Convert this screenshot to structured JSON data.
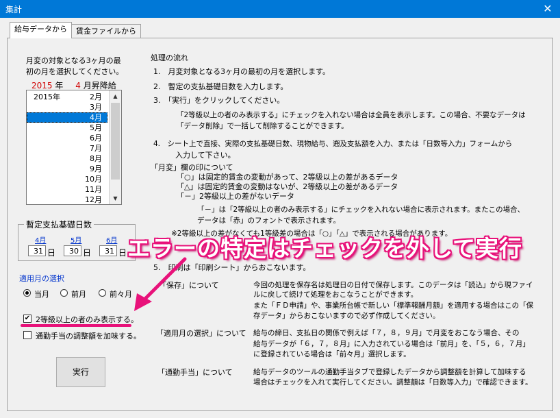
{
  "window": {
    "title": "集計",
    "close": "✕"
  },
  "tabs": [
    {
      "label": "給与データから"
    },
    {
      "label": "賃金ファイルから"
    }
  ],
  "left": {
    "instruction": [
      "月変の対象となる3ヶ月の最",
      "初の月を選択してください。"
    ],
    "selected_year": "2015",
    "year_suffix": "年",
    "selected_month": "4",
    "month_suffix": "月昇降給",
    "list": [
      {
        "year": "2015年",
        "month": "2月"
      },
      {
        "year": "",
        "month": "3月"
      },
      {
        "year": "",
        "month": "4月"
      },
      {
        "year": "",
        "month": "5月"
      },
      {
        "year": "",
        "month": "6月"
      },
      {
        "year": "",
        "month": "7月"
      },
      {
        "year": "",
        "month": "8月"
      },
      {
        "year": "",
        "month": "9月"
      },
      {
        "year": "",
        "month": "10月"
      },
      {
        "year": "",
        "month": "11月"
      },
      {
        "year": "",
        "month": "12月"
      }
    ],
    "selected_index": 2,
    "days_frame_title": "暫定支払基礎日数",
    "days": [
      {
        "month": "4月",
        "value": "31",
        "unit": "日"
      },
      {
        "month": "5月",
        "value": "30",
        "unit": "日"
      },
      {
        "month": "6月",
        "value": "31",
        "unit": "日"
      }
    ],
    "apply_month_title": "適用月の選択",
    "radios": [
      {
        "label": "当月",
        "selected": true
      },
      {
        "label": "前月",
        "selected": false
      },
      {
        "label": "前々月",
        "selected": false
      }
    ],
    "checkbox_grade": {
      "label": "2等級以上の者のみ表示する。",
      "checked": true
    },
    "checkbox_commute": {
      "label": "通勤手当の調整額を加味する。",
      "checked": false
    },
    "exec_button": "実行"
  },
  "flow": {
    "title": "処理の流れ",
    "step1": "1.　月変対象となる3ヶ月の最初の月を選択します。",
    "step2": "2.　暫定の支払基礎日数を入力します。",
    "step3": "3.　「実行」をクリックしてください。",
    "step3_note1": "「2等級以上の者のみ表示する」にチェックを入れない場合は全員を表示します。この場合、不要なデータは",
    "step3_note2": "「データ削除」で一括して削除することができます。",
    "step4_1": "4.　シート上で直接、実際の支払基礎日数、現物給与、遡及支払額を入力、または「日数等入力」フォームから",
    "step4_2": "入力して下さい。",
    "mark_title": "「月変」欄の印について",
    "mark1": "「○」は固定的賃金の変動があって、2等級以上の差があるデータ",
    "mark2": "「△」は固定的賃金の変動はないが、2等級以上の差があるデータ",
    "mark3": "「－」2等級以上の差がないデータ",
    "dash_note1": "「－」は「2等級以上の者のみ表示する」にチェックを入れない場合に表示されます。またこの場合、",
    "dash_note2": "データは「赤」のフォントで表示されます。",
    "note2_partial": "※2等級以上の差がなくても1等級差の場合は「○」「△」で表示される場合があります。",
    "step5": "5.　印刷は「印刷シート」からおこないます。"
  },
  "notes": [
    {
      "head": "「保存」について",
      "lines": [
        "今回の処理を保存名は処理日の日付で保存します。このデータは「読込」から現ファイ",
        "ルに戻して続けて処理をおこなうことができます。",
        "また「ＦＤ申請」や、事業所台帳で新しい「標準報酬月額」を適用する場合はこの「保",
        "存データ」からおこないますので必ず作成してください。"
      ]
    },
    {
      "head": "「適用月の選択」について",
      "lines": [
        "給与の締日、支払日の関係で例えば「７，８，９月」で月変をおこなう場合、その",
        "給与データが「６，７，８月」に入力されている場合は「前月」を、「５，６，７月」",
        "に登録されている場合は「前々月」選択します。"
      ]
    },
    {
      "head": "「通勤手当」について",
      "lines": [
        "給与データのツールの通勤手当タブで登録したデータから調整額を計算して加味する",
        "場合はチェックを入れて実行してください。調整額は「日数等入力」で確認できます。"
      ]
    }
  ],
  "annotation": {
    "text": "エラーの特定はチェックを外して実行",
    "color": "#e8127a"
  }
}
